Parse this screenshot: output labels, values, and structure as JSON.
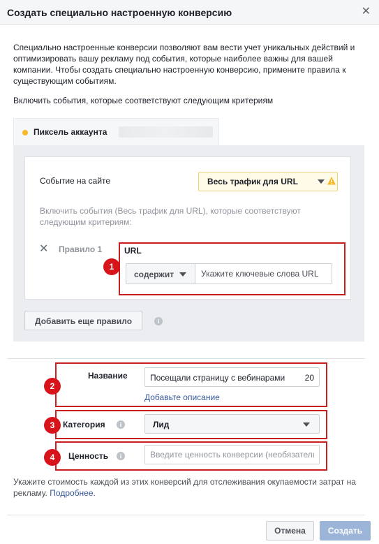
{
  "dialog": {
    "title": "Создать специально настроенную конверсию",
    "intro": "Специально настроенные конверсии позволяют вам вести учет уникальных действий и оптимизировать вашу рекламу под события, которые наиболее важны для вашей компании. Чтобы создать специально настроенную конверсию, примените правила к существующим событиям.",
    "include_events_label": "Включить события, которые соответствуют следующим критериям"
  },
  "pixel_tab": {
    "label": "Пиксель аккаунта",
    "dot_color": "#f7b928"
  },
  "rule_card": {
    "site_event_label": "Событие на сайте",
    "traffic_select": "Весь трафик для URL",
    "sub_criteria": "Включить события (Весь трафик для URL), которые соответствуют следующим критериям:",
    "rule_label": "Правило 1",
    "url_label": "URL",
    "condition_select": "содержит",
    "url_placeholder": "Укажите ключевые слова URL"
  },
  "add_rule_button": "Добавить еще правило",
  "form": {
    "name_label": "Название",
    "name_value": "Посещали страницу с вебинарами",
    "name_count": "20",
    "add_description": "Добавьте описание",
    "category_label": "Категория",
    "category_value": "Лид",
    "value_label": "Ценность",
    "value_placeholder": "Введите ценность конверсии (необязатель"
  },
  "footnote": {
    "text": "Укажите стоимость каждой из этих конверсий для отслеживания окупаемости затрат на рекламу.",
    "link": "Подробнее."
  },
  "buttons": {
    "cancel": "Отмена",
    "create": "Создать"
  },
  "annotations": {
    "badge_1": "1",
    "badge_2": "2",
    "badge_3": "3",
    "badge_4": "4",
    "color": "#c81e1e"
  },
  "colors": {
    "link": "#365899",
    "create_disabled": "#9cb4d8",
    "warning": "#f0d57a"
  }
}
